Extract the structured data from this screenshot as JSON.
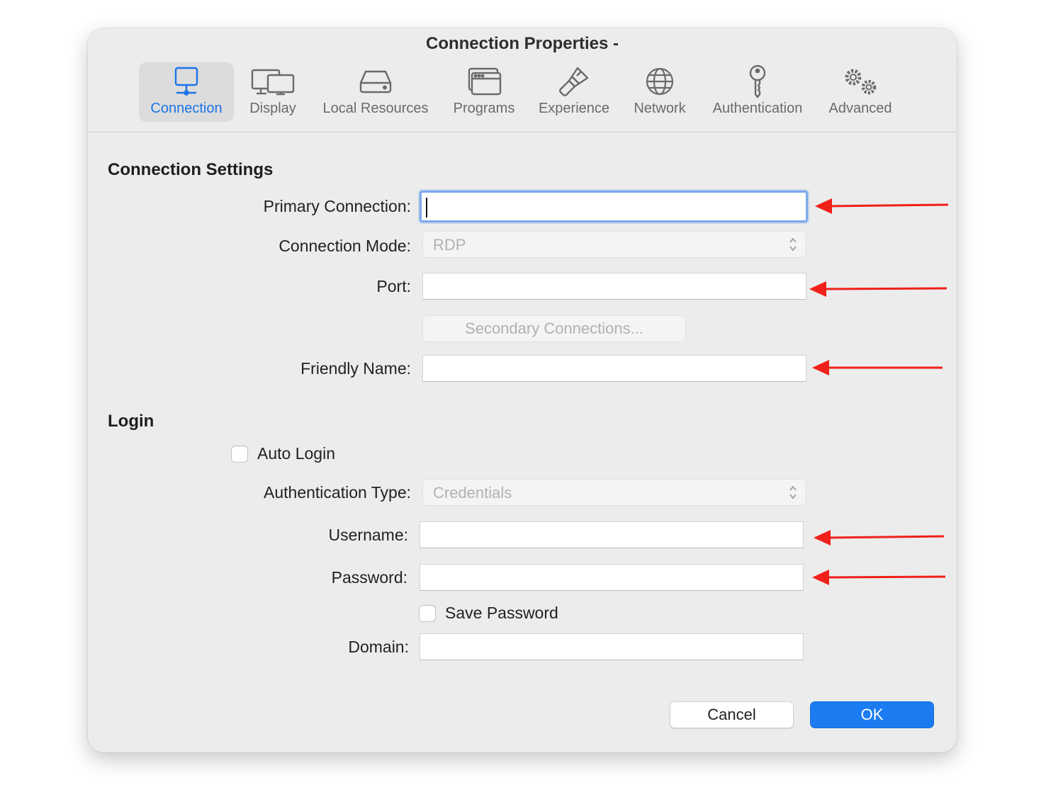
{
  "window": {
    "title": "Connection Properties -"
  },
  "tabs": [
    {
      "label": "Connection",
      "icon": "monitor-icon",
      "active": true
    },
    {
      "label": "Display",
      "icon": "displays-icon",
      "active": false
    },
    {
      "label": "Local Resources",
      "icon": "disk-drive-icon",
      "active": false
    },
    {
      "label": "Programs",
      "icon": "app-window-icon",
      "active": false
    },
    {
      "label": "Experience",
      "icon": "paintbrush-icon",
      "active": false
    },
    {
      "label": "Network",
      "icon": "globe-icon",
      "active": false
    },
    {
      "label": "Authentication",
      "icon": "key-icon",
      "active": false
    },
    {
      "label": "Advanced",
      "icon": "gears-icon",
      "active": false
    }
  ],
  "connection_settings": {
    "heading": "Connection Settings",
    "primary_connection": {
      "label": "Primary Connection:",
      "value": ""
    },
    "connection_mode": {
      "label": "Connection Mode:",
      "value": "RDP"
    },
    "port": {
      "label": "Port:",
      "value": ""
    },
    "secondary_connections_button": "Secondary Connections...",
    "friendly_name": {
      "label": "Friendly Name:",
      "value": ""
    }
  },
  "login": {
    "heading": "Login",
    "auto_login": {
      "label": "Auto Login",
      "checked": false
    },
    "authentication_type": {
      "label": "Authentication Type:",
      "value": "Credentials"
    },
    "username": {
      "label": "Username:",
      "value": ""
    },
    "password": {
      "label": "Password:",
      "value": ""
    },
    "save_password": {
      "label": "Save Password",
      "checked": false
    },
    "domain": {
      "label": "Domain:",
      "value": ""
    }
  },
  "buttons": {
    "cancel": "Cancel",
    "ok": "OK"
  },
  "colors": {
    "accent": "#1b7cf2",
    "active_tab_text": "#1b73e8",
    "annotation_arrow": "#f0201a"
  }
}
